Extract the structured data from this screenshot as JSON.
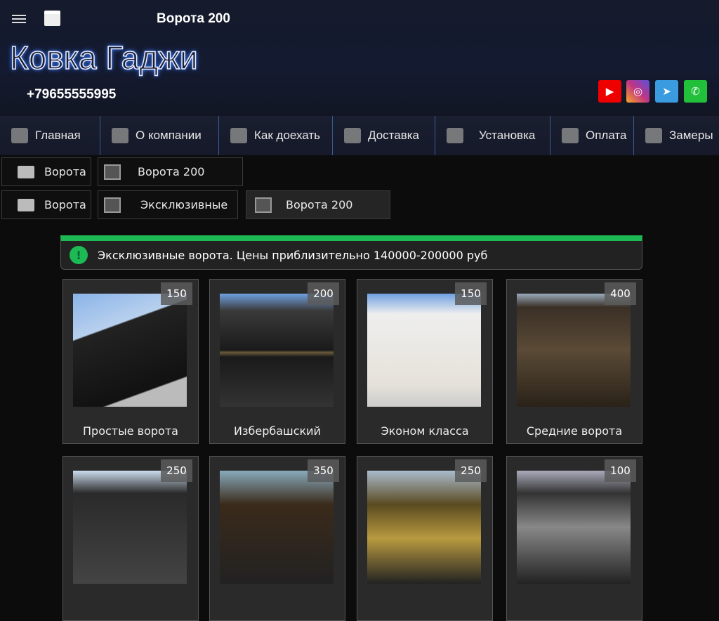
{
  "header": {
    "title": "Ворота 200",
    "logo": "Ковка Гаджи",
    "phone": "+79655555995"
  },
  "social": [
    {
      "name": "youtube",
      "color": "#e00",
      "glyph": "▶"
    },
    {
      "name": "instagram",
      "color": "#c13584",
      "glyph": "◎"
    },
    {
      "name": "telegram",
      "color": "#3a9be0",
      "glyph": "➤"
    },
    {
      "name": "whatsapp",
      "color": "#22c03a",
      "glyph": "✆"
    }
  ],
  "nav": [
    "Главная",
    "О компании",
    "Как доехать",
    "Доставка",
    "Установка",
    "Оплата",
    "Замеры"
  ],
  "breadcrumbs": {
    "row1": [
      "Ворота",
      "Ворота 200"
    ],
    "row2": [
      "Ворота",
      "Эксклюзивные",
      "Ворота 200"
    ]
  },
  "notice": {
    "text": "Эксклюзивные ворота. Цены приблизительно 140000-200000 руб",
    "color": "#1db954"
  },
  "cards": [
    {
      "price": "150",
      "caption": "Простые ворота"
    },
    {
      "price": "200",
      "caption": "Избербашский"
    },
    {
      "price": "150",
      "caption": "Эконом класса"
    },
    {
      "price": "400",
      "caption": "Средние ворота"
    },
    {
      "price": "250",
      "caption": ""
    },
    {
      "price": "350",
      "caption": ""
    },
    {
      "price": "250",
      "caption": ""
    },
    {
      "price": "100",
      "caption": ""
    }
  ]
}
